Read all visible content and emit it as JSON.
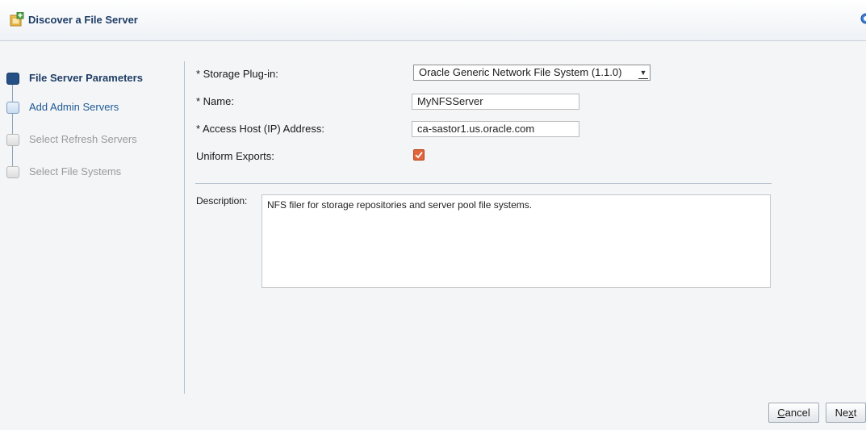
{
  "window": {
    "title": "Discover a File Server"
  },
  "icons": {
    "title": "discover-file-server-icon",
    "help": "help-icon",
    "dropdown": "chevron-down-icon",
    "checkbox": "checkbox-checked-icon"
  },
  "train": {
    "steps": [
      {
        "label": "File Server Parameters",
        "state": "current"
      },
      {
        "label": "Add Admin Servers",
        "state": "visited"
      },
      {
        "label": "Select Refresh Servers",
        "state": "disabled"
      },
      {
        "label": "Select File Systems",
        "state": "disabled"
      }
    ]
  },
  "form": {
    "storage_plugin": {
      "label": "* Storage Plug-in:",
      "value": "Oracle Generic Network File System (1.1.0)"
    },
    "name": {
      "label": "* Name:",
      "value": "MyNFSServer"
    },
    "access_host": {
      "label": "* Access Host (IP) Address:",
      "value": "ca-sastor1.us.oracle.com"
    },
    "uniform_exports": {
      "label": "Uniform Exports:",
      "checked": true
    },
    "description": {
      "label": "Description:",
      "value": "NFS filer for storage repositories and server pool file systems."
    }
  },
  "buttons": {
    "cancel": {
      "first": "C",
      "rest": "ancel"
    },
    "next": {
      "first": "Ne",
      "mnemonic": "x",
      "rest": "t"
    }
  },
  "colors": {
    "accent": "#1f3d66",
    "train_current": "#264f86",
    "checkbox": "#e2643b",
    "panel_bg": "#f3f5f7"
  }
}
